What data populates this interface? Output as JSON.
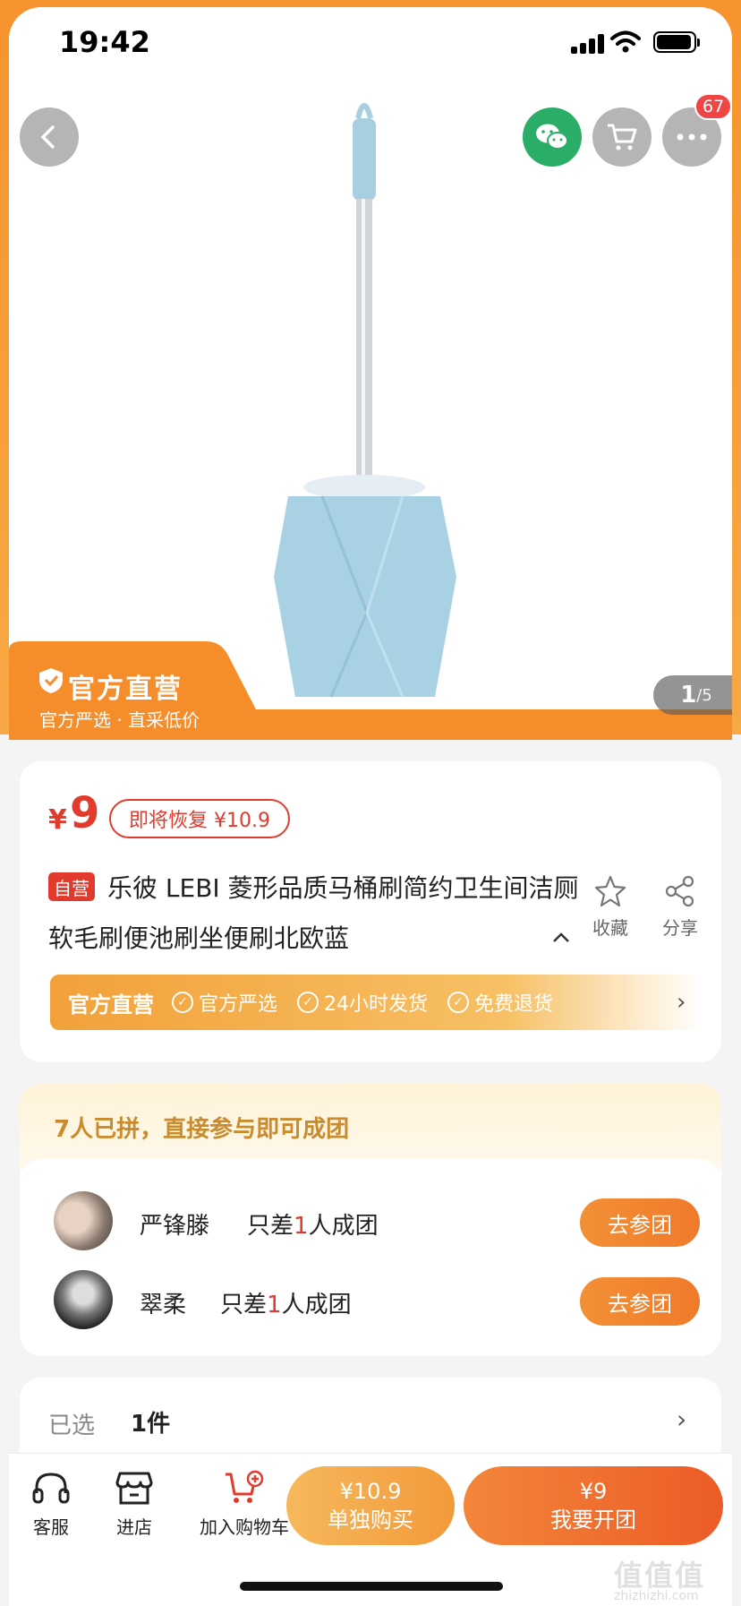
{
  "status_bar": {
    "time": "19:42"
  },
  "hero": {
    "cart_badge": "67",
    "official_title": "官方直营",
    "official_sub": "官方严选 · 直采低价",
    "page_current": "1",
    "page_total": "/5"
  },
  "product": {
    "currency": "¥",
    "price": "9",
    "restore_tag": "即将恢复 ¥10.9",
    "self_tag": "自营",
    "title": "乐彼 LEBI 菱形品质马桶刷简约卫生间洁厕软毛刷便池刷坐便刷北欧蓝",
    "collapse_icon": "chevron-up-icon",
    "favorite_label": "收藏",
    "share_label": "分享"
  },
  "perks": {
    "main": "官方直营",
    "items": [
      "官方严选",
      "24小时发货",
      "免费退货"
    ]
  },
  "group": {
    "header": "7人已拼，直接参与即可成团",
    "rows": [
      {
        "name": "严锋滕",
        "need_prefix": "只差",
        "need_num": "1",
        "need_suffix": "人成团",
        "button": "去参团"
      },
      {
        "name": "翠柔",
        "need_prefix": "只差",
        "need_num": "1",
        "need_suffix": "人成团",
        "button": "去参团"
      }
    ]
  },
  "selection": {
    "label": "已选",
    "value": "1件"
  },
  "bottom_bar": {
    "service": "客服",
    "store": "进店",
    "add_cart": "加入购物车",
    "solo_price": "¥10.9",
    "solo_label": "单独购买",
    "group_price": "¥9",
    "group_label": "我要开团"
  },
  "watermark": {
    "main": "值值值",
    "sub": "zhizhizhi.com"
  },
  "colors": {
    "accent": "#f7932d",
    "price_red": "#e23b2e",
    "wechat_green": "#2aae67"
  }
}
